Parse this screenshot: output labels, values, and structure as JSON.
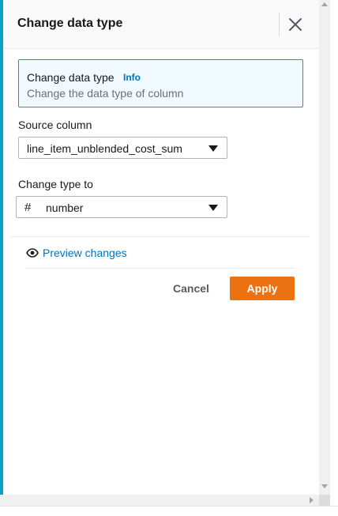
{
  "panel": {
    "title": "Change data type",
    "close_icon": "close-icon"
  },
  "info_box": {
    "title": "Change data type",
    "link": "Info",
    "description": "Change the data type of column"
  },
  "source_column": {
    "label": "Source column",
    "value": "line_item_unblended_cost_sum"
  },
  "change_type": {
    "label": "Change type to",
    "type_icon": "#",
    "value": "number"
  },
  "preview": {
    "label": "Preview changes",
    "icon": "eye-icon"
  },
  "actions": {
    "cancel": "Cancel",
    "apply": "Apply"
  },
  "colors": {
    "accent": "#0aa2c3",
    "primary_button": "#ec7211",
    "link": "#0073bb",
    "info_background": "#f1faff",
    "info_border": "#00a1c9"
  }
}
